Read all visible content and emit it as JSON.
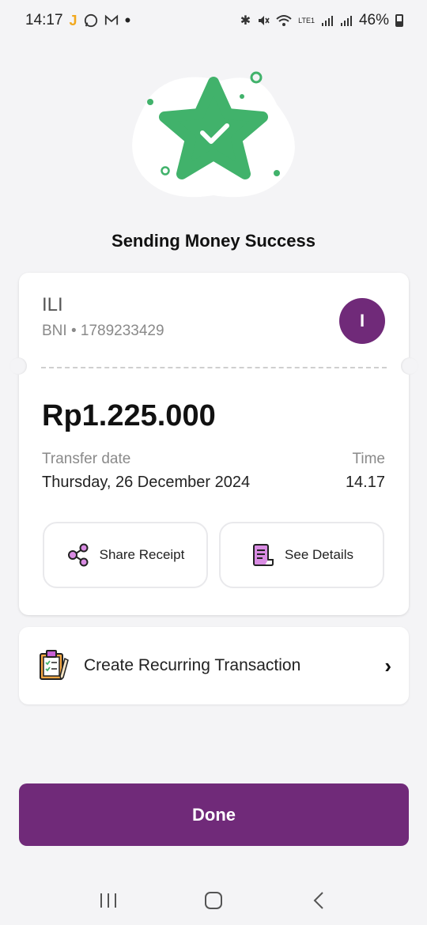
{
  "status_bar": {
    "time": "14:17",
    "battery": "46%",
    "network_label": "LTE1"
  },
  "title": "Sending Money Success",
  "recipient": {
    "name": "ILI",
    "bank_account": "BNI • 1789233429",
    "avatar_initial": "I"
  },
  "transfer": {
    "amount": "Rp1.225.000",
    "date_label": "Transfer date",
    "date_value": "Thursday, 26 December 2024",
    "time_label": "Time",
    "time_value": "14.17"
  },
  "actions": {
    "share_label": "Share Receipt",
    "details_label": "See Details"
  },
  "recurring": {
    "label": "Create Recurring Transaction"
  },
  "done_label": "Done",
  "colors": {
    "brand": "#702a79",
    "success": "#41b26b"
  }
}
